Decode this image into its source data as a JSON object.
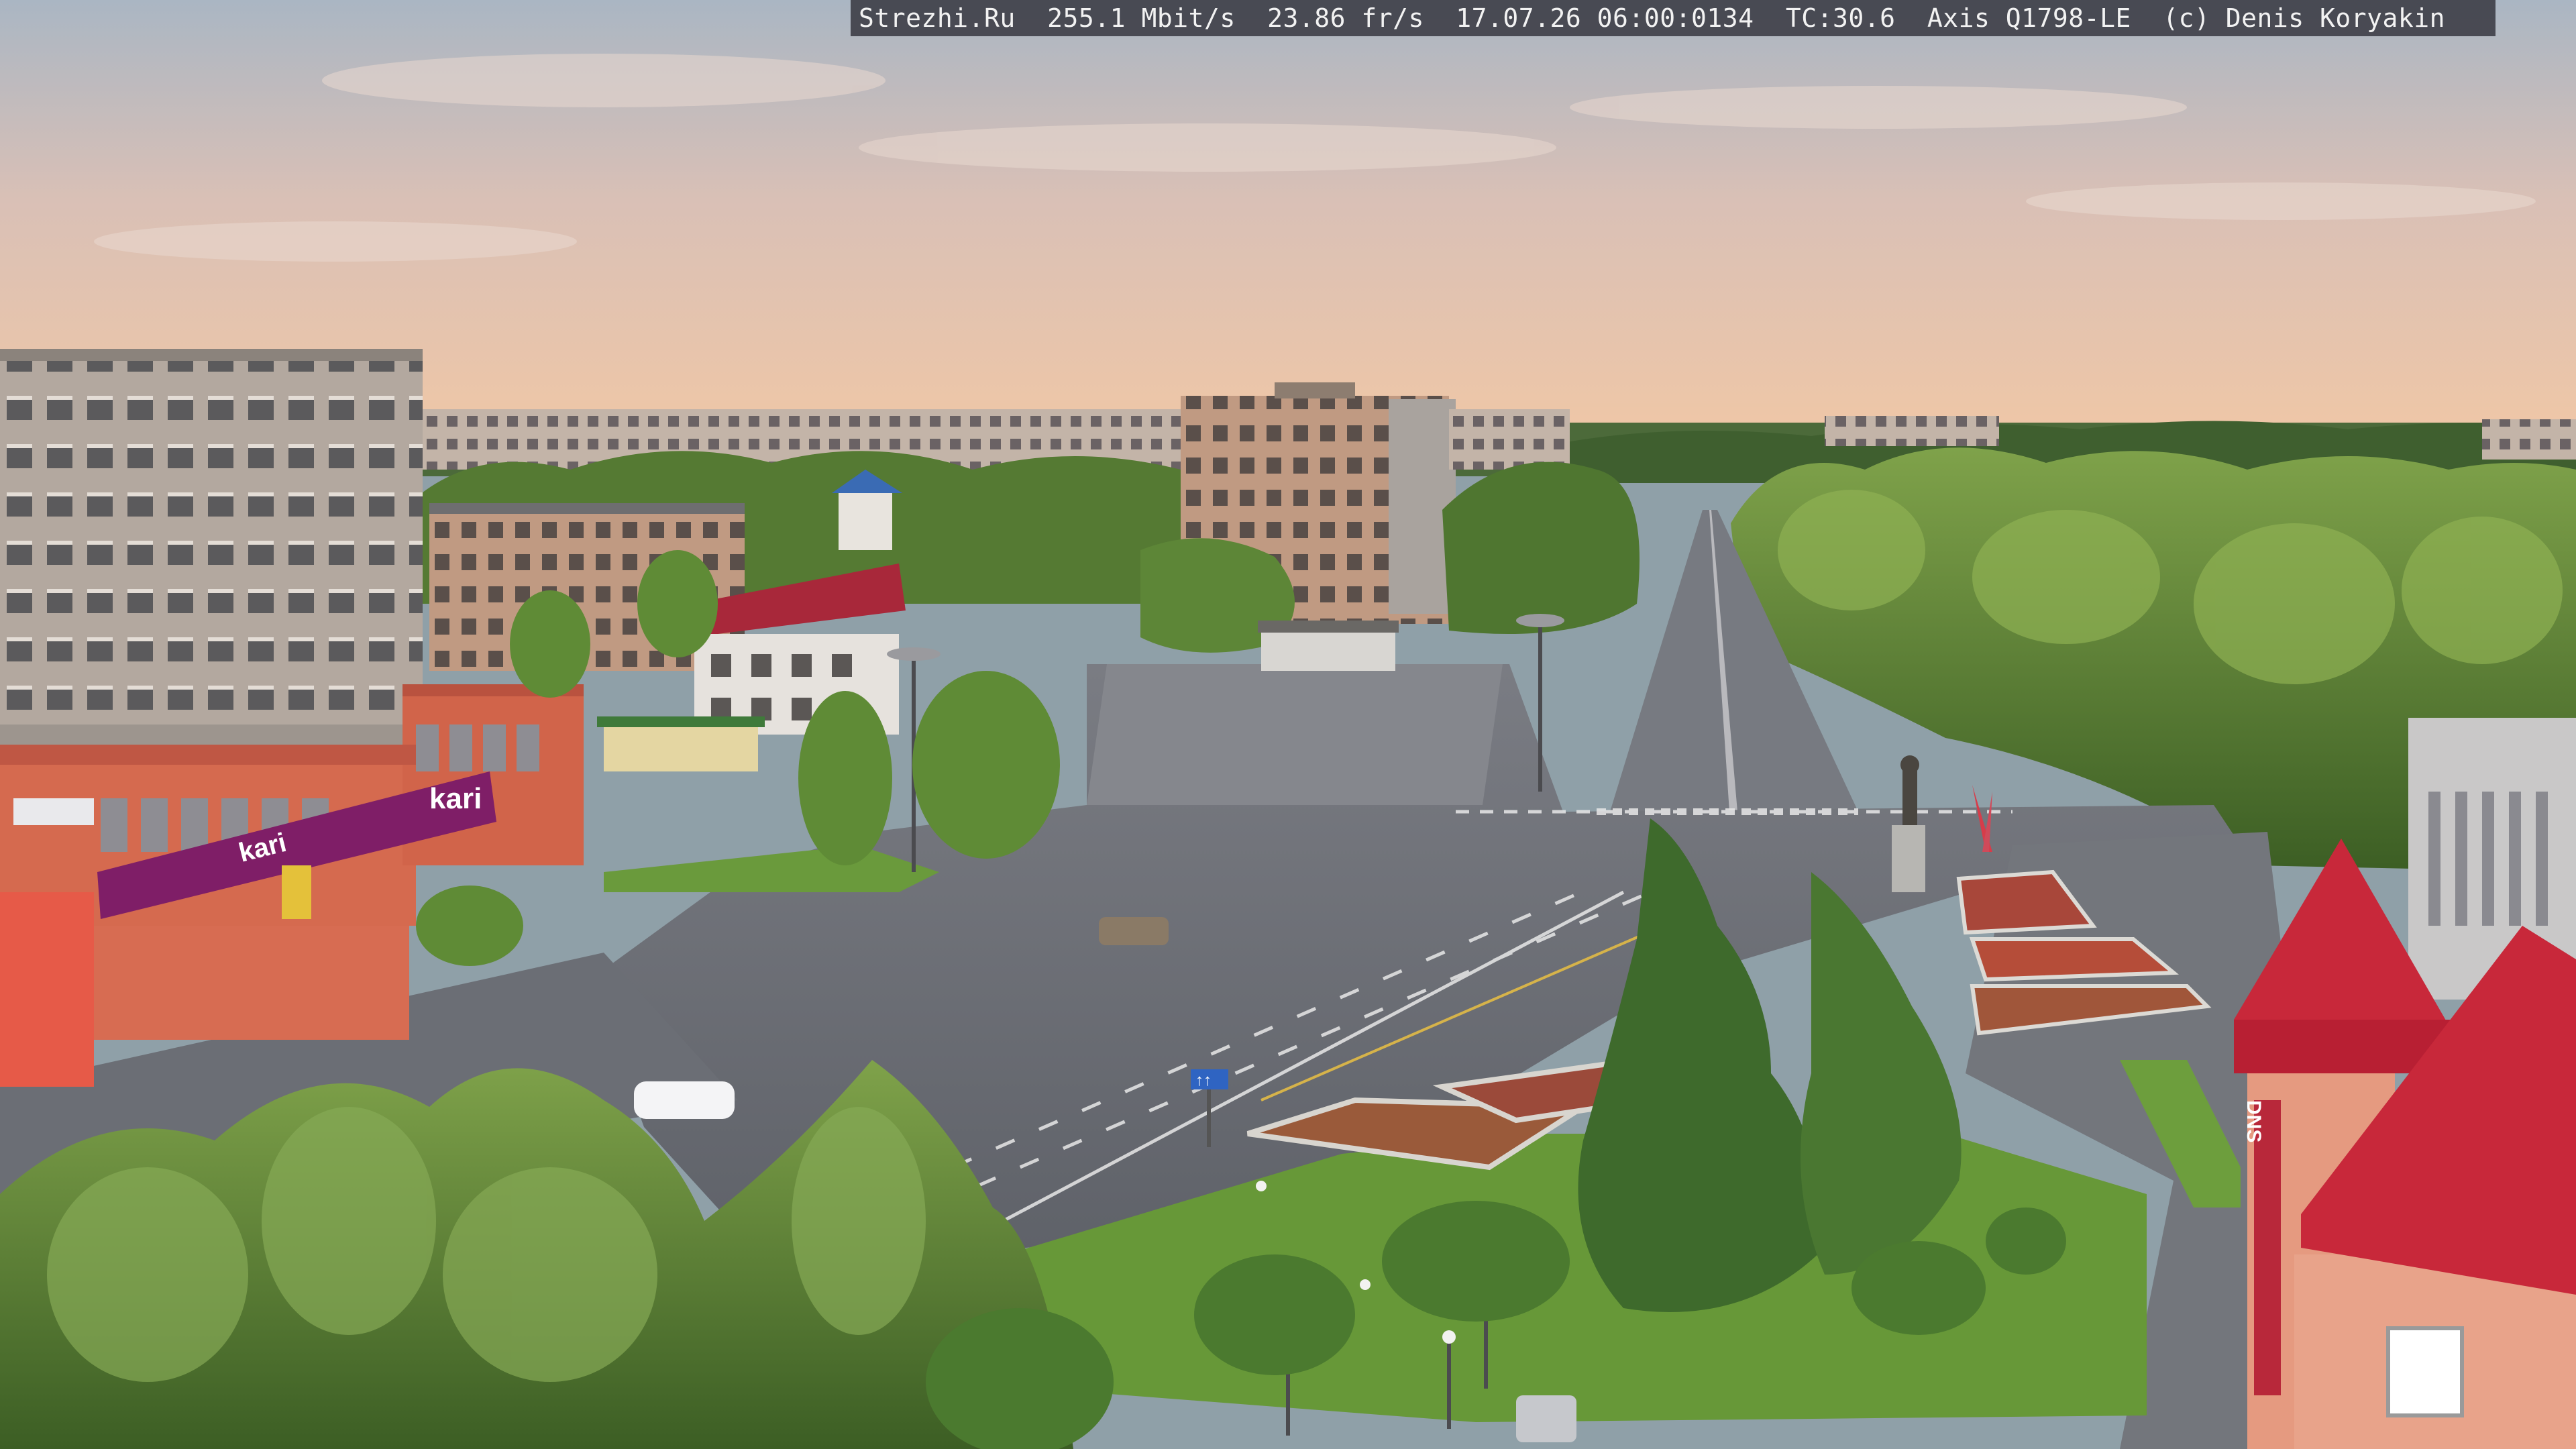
{
  "overlay": {
    "site": "Strezhi.Ru",
    "bitrate": "255.1 Mbit/s",
    "framerate": "23.86 fr/s",
    "timestamp": "17.07.26 06:00:0134",
    "temperature": "TC:30.6",
    "camera_model": "Axis Q1798-LE",
    "copyright": "(c) Denis Koryakin"
  },
  "storefront": {
    "brand_sign": "kari",
    "brand_sign_lower": "kari",
    "tower_sign": "DNS"
  },
  "road_signs": {
    "lane_sign": "↑↑"
  },
  "palette": {
    "sky_top": "#b9c2c9",
    "sky_horizon": "#efc0a0",
    "foliage": "#4e7a2e",
    "road": "#6e7178",
    "roof_red": "#c8283a"
  }
}
